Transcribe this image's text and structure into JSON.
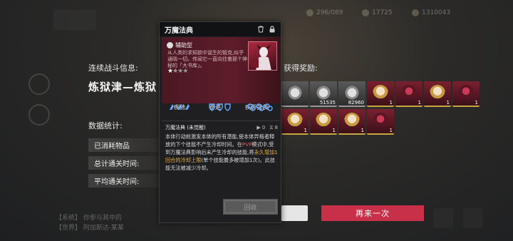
{
  "top_bar": {
    "res1": "296/089",
    "res2": "17725",
    "res3": "1310043"
  },
  "battle_info": {
    "label": "连续战斗信息:",
    "stage": "炼狱津—炼狱"
  },
  "stats": {
    "label": "数据统计:",
    "rows": [
      "已消耗物品",
      "总计通关时间:",
      "平均通关时间:"
    ]
  },
  "rewards": {
    "label": "获得奖励:",
    "row1": [
      {
        "kind": "gray",
        "num": ""
      },
      {
        "kind": "gray",
        "num": "51535"
      },
      {
        "kind": "gray",
        "num": "82960"
      },
      {
        "kind": "gold",
        "num": "1"
      },
      {
        "kind": "dark",
        "num": "1"
      },
      {
        "kind": "gold",
        "num": "1"
      },
      {
        "kind": "dark",
        "num": "1"
      }
    ],
    "row2": [
      {
        "kind": "gold",
        "num": "1"
      },
      {
        "kind": "gold",
        "num": "1"
      },
      {
        "kind": "gold",
        "num": "1"
      },
      {
        "kind": "dark",
        "num": "1"
      }
    ]
  },
  "buttons": {
    "again": "再来一次"
  },
  "chat": {
    "line1": "【系统】 你参与其中的",
    "line2": "【世界】 阿加斯达·某某"
  },
  "popup": {
    "title": "万魔法典",
    "type_label": "辅助型",
    "description": "从人类的求知欲中诞生的智克,似乎通晓一切。传闻它一直向往着那个神秘的「大书库」。",
    "rating_filled": 1,
    "rating_total": 4,
    "tags": [
      "疾驰",
      "奋进",
      "疾影强袭"
    ],
    "skill_title": "万魔法典 (未觉醒)",
    "skill_sp": "0",
    "skill_cd": "8",
    "skill_text": {
      "p1": "本体行动前激发本体的所有潜能,使本体异格者释放的下个技能不产生冷却时间。在",
      "pvp": "PVP",
      "p2": "模式中,受到万魔法典影响后未产生冷却的技能,将",
      "gold": "永久增加1回合的冷却上限",
      "p3": "(单个技能最多被增加1次)。此技能无法被减少冷却。"
    },
    "recycle_label": "回收"
  },
  "colors": {
    "accent_red": "#c8304a",
    "highlight_gold": "#e3b04a",
    "highlight_pvp": "#e05a72",
    "card_bg": "#5e1c2a"
  }
}
